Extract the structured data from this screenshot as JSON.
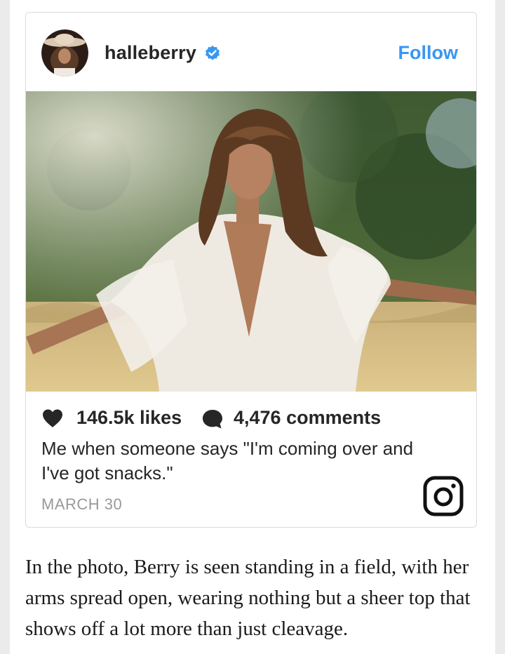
{
  "post": {
    "username": "halleberry",
    "follow_label": "Follow",
    "likes": "146.5k likes",
    "comments": "4,476 comments",
    "caption": "Me when someone says \"I'm coming over and I've got snacks.\"",
    "date": "MARCH 30"
  },
  "article": {
    "text": "In the photo, Berry is seen standing in a field, with her arms spread open, wearing nothing but a sheer top that shows off a lot more than just cleavage."
  },
  "colors": {
    "link": "#3897f0",
    "text": "#262626",
    "muted": "#999999",
    "border": "#dbdbdb"
  },
  "icons": [
    "verified-badge-icon",
    "heart-icon",
    "comment-icon",
    "instagram-logo-icon"
  ]
}
